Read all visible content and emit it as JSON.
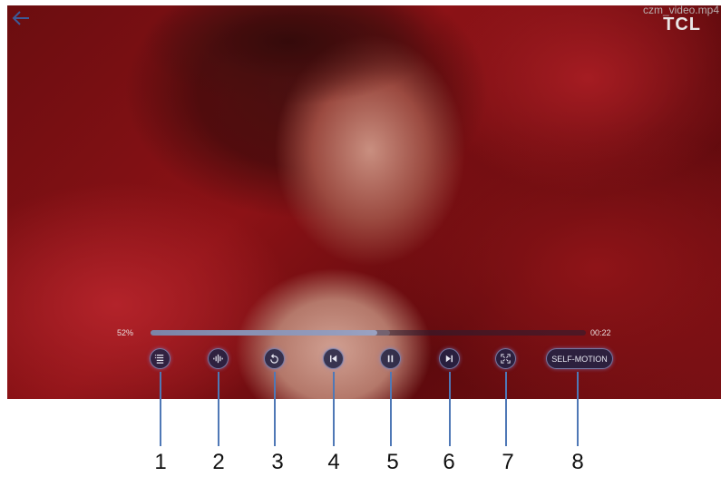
{
  "player": {
    "file_name": "czm_video.mp4",
    "brand": "TCL",
    "progress_label": "52%",
    "progress": 0.52,
    "time": "00:22",
    "back_icon": "arrow-left-icon"
  },
  "controls": [
    {
      "name": "playlist-button",
      "icon": "playlist-icon"
    },
    {
      "name": "audio-track-button",
      "icon": "audio-wave-icon"
    },
    {
      "name": "repeat-button",
      "icon": "repeat-icon"
    },
    {
      "name": "previous-button",
      "icon": "skip-previous-icon"
    },
    {
      "name": "pause-button",
      "icon": "pause-icon"
    },
    {
      "name": "next-button",
      "icon": "skip-next-icon"
    },
    {
      "name": "aspect-ratio-button",
      "icon": "fit-screen-icon"
    }
  ],
  "mode_button_label": "SELF-MOTION",
  "callouts": [
    "1",
    "2",
    "3",
    "4",
    "5",
    "6",
    "7",
    "8"
  ],
  "colors": {
    "callout_line": "#4f78b6",
    "control_bg": "#1e2346",
    "progress_fill": "#8a92b6"
  }
}
